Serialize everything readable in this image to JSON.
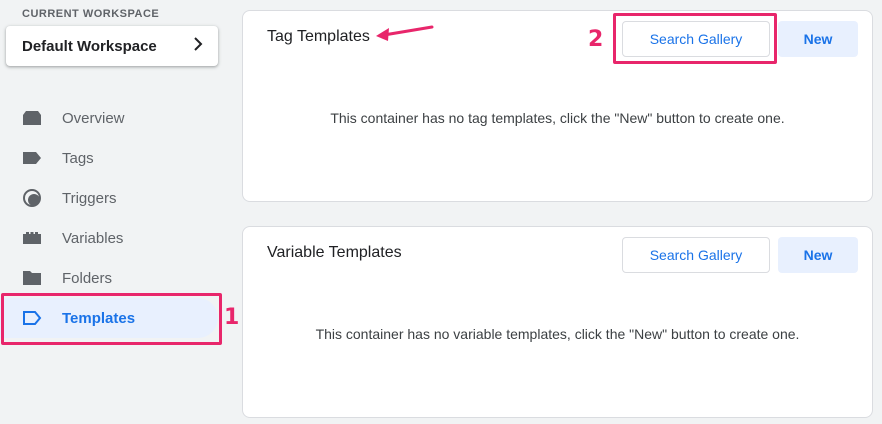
{
  "sidebar": {
    "workspace_label": "CURRENT WORKSPACE",
    "workspace_name": "Default Workspace",
    "items": [
      {
        "label": "Overview",
        "icon": "overview-icon"
      },
      {
        "label": "Tags",
        "icon": "tag-icon"
      },
      {
        "label": "Triggers",
        "icon": "trigger-icon"
      },
      {
        "label": "Variables",
        "icon": "variables-icon"
      },
      {
        "label": "Folders",
        "icon": "folder-icon"
      },
      {
        "label": "Templates",
        "icon": "template-icon",
        "active": true
      }
    ]
  },
  "tag_templates": {
    "title": "Tag Templates",
    "search_gallery_label": "Search Gallery",
    "new_label": "New",
    "empty_message": "This container has no tag templates, click the \"New\" button to create one."
  },
  "variable_templates": {
    "title": "Variable Templates",
    "search_gallery_label": "Search Gallery",
    "new_label": "New",
    "empty_message": "This container has no variable templates, click the \"New\" button to create one."
  },
  "annotations": {
    "step_1": "1",
    "step_2": "2",
    "highlight_color": "#e8266b"
  },
  "colors": {
    "accent": "#1a73e8",
    "active_bg": "#e8f0fe",
    "page_bg": "#f1f3f4"
  }
}
